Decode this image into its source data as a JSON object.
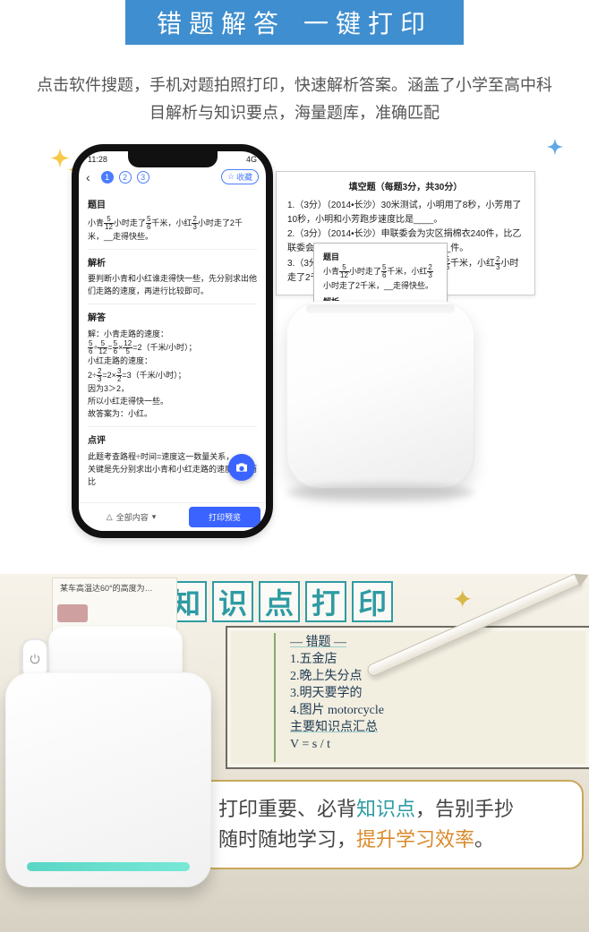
{
  "banner": {
    "left": "错题解答",
    "right": "一键打印"
  },
  "description": "点击软件搜题，手机对题拍照打印，快速解析答案。涵盖了小学至高中科目解析与知识要点，海量题库，准确匹配",
  "phone": {
    "time": "11:28",
    "signal": "4G",
    "back": "‹",
    "page_active": "1",
    "page_dots": [
      "1",
      "2",
      "3"
    ],
    "collect": "收藏",
    "sections": {
      "question_title": "题目",
      "question_text_a": "小青",
      "question_text_b": "小时走了",
      "question_text_c": "千米，小红",
      "question_text_d": "小时走了2千米，__走得快些。",
      "analysis_title": "解析",
      "analysis_text": "要判断小青和小红谁走得快一些，先分别求出他们走路的速度，再进行比较即可。",
      "answer_title": "解答",
      "answer_lead": "解：小青走路的速度：",
      "answer_l1a": "÷",
      "answer_l1b": "=",
      "answer_l1c": "×",
      "answer_l1d": "=2（千米/小时）；",
      "answer_l2": "小红走路的速度：",
      "answer_l3": "2÷",
      "answer_l3b": "=2×",
      "answer_l3c": "=3（千米/小时）；",
      "answer_l4": "因为3＞2，",
      "answer_l5": "所以小红走得快一些。",
      "answer_l6": "故答案为：小红。",
      "comment_title": "点评",
      "comment_text1": "此题考查路程÷时间=速度这一数量关系，",
      "comment_text2": "关键是先分别求出小青和小红走路的速度，进而比"
    },
    "bottombar": {
      "left": "全部内容",
      "right": "打印预览"
    }
  },
  "paper_bg": {
    "title": "填空题（每题3分，共30分）",
    "l1": "1.（3分）（2014•长沙）30米测试，小明用了8秒，小芳用了10秒，小明和小芳跑步速度比是____。",
    "l2": "2.（3分）（2014•长沙）申联委会为灾区捐棉衣240件，比乙联委会多捐了20%，比乙联委会多捐____件。",
    "l3a": "3.（3分）（2014•长沙）小青",
    "l3b": "小时走了",
    "l3c": "千米，小红",
    "l3d": "小时走了2千米，____走得快些。"
  },
  "paper_slip": {
    "t1": "题目",
    "body_a": "小青",
    "body_b": "小时走了",
    "body_c": "千米，小红",
    "body_d": "小时走了2千米，__走得快些。",
    "t2": "解析"
  },
  "bs_title_chars": [
    "知",
    "识",
    "点",
    "打",
    "印"
  ],
  "notebook": {
    "l0": "— 错题 —",
    "l1": "1.五金店",
    "l2": "2.晚上失分点",
    "l3": "3.明天要学的",
    "l4": "4.图片 motorcycle",
    "l5": "主要知识点汇总",
    "l6": "V = s / t"
  },
  "side_paper": "某车高温达60°的高度为…",
  "bubble": {
    "line1_a": "打印重要、必背",
    "line1_b": "知识点",
    "line1_c": "，告别手抄",
    "line2_a": "随时随地学习，",
    "line2_b": "提升学习效率",
    "line2_c": "。"
  }
}
